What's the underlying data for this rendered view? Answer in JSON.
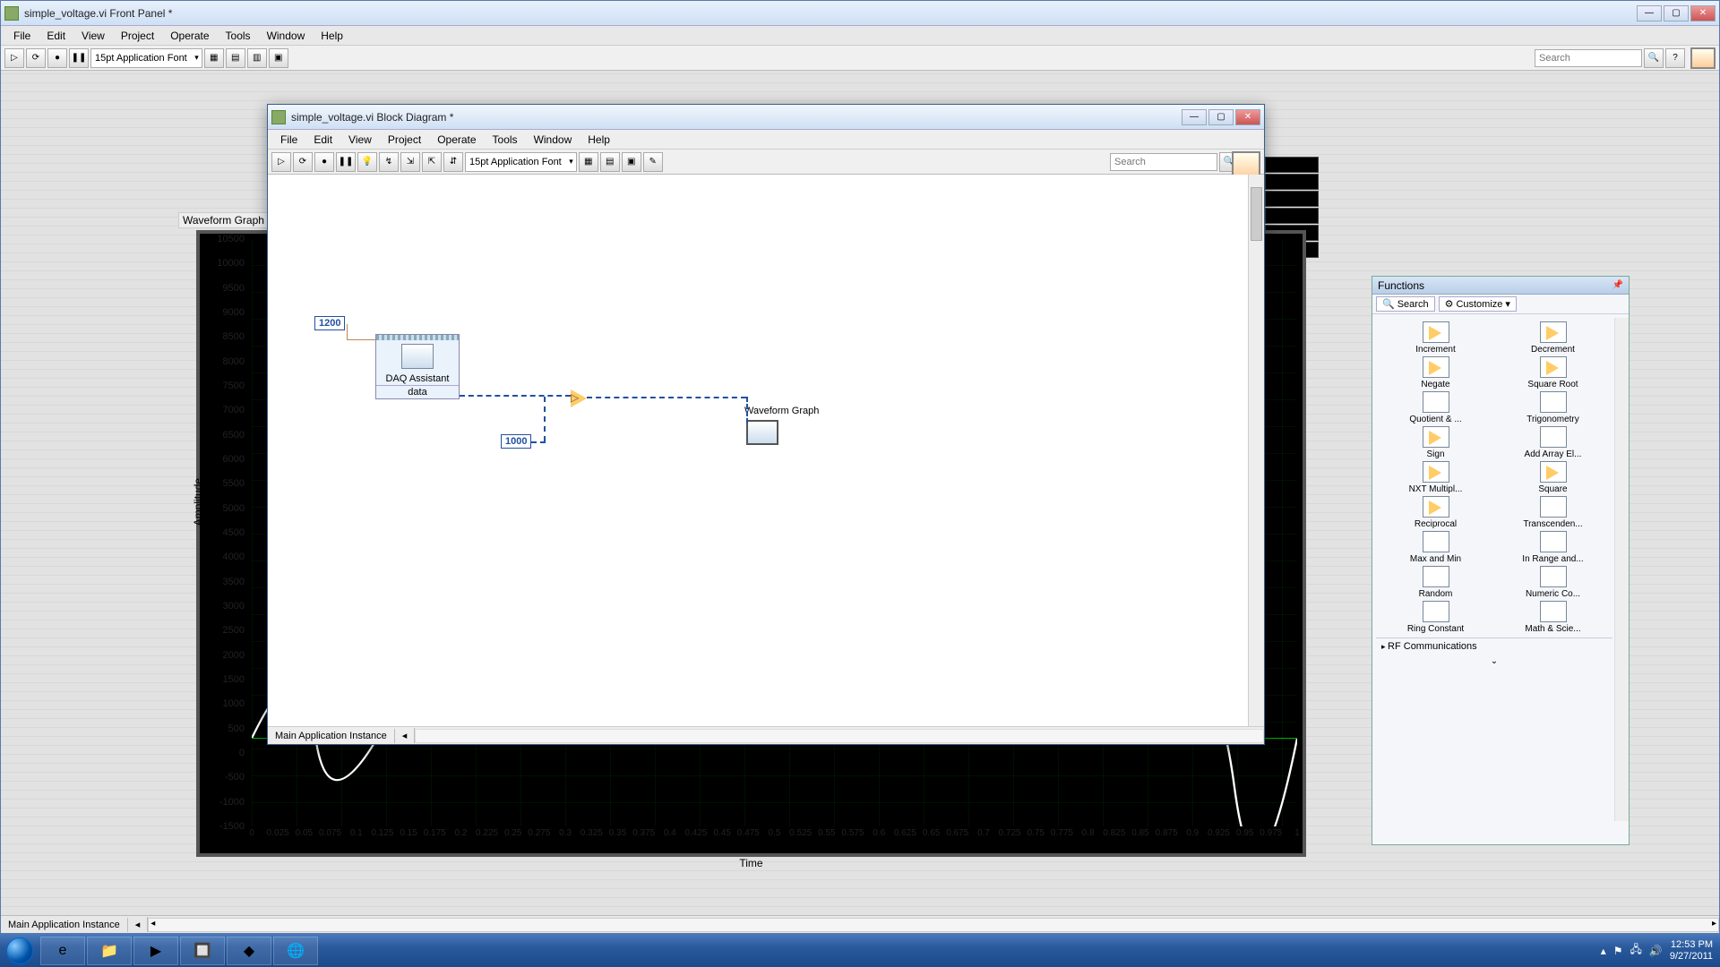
{
  "main_window": {
    "title": "simple_voltage.vi Front Panel *",
    "menus": [
      "File",
      "Edit",
      "View",
      "Project",
      "Operate",
      "Tools",
      "Window",
      "Help"
    ],
    "font_combo": "15pt Application Font",
    "search_placeholder": "Search",
    "status_tab": "Main Application Instance"
  },
  "graph": {
    "label": "Waveform Graph",
    "y_label": "Amplitude",
    "x_label": "Time",
    "y_ticks": [
      "10500",
      "10000",
      "9500",
      "9000",
      "8500",
      "8000",
      "7500",
      "7000",
      "6500",
      "6000",
      "5500",
      "5000",
      "4500",
      "4000",
      "3500",
      "3000",
      "2500",
      "2000",
      "1500",
      "1000",
      "500",
      "0",
      "-500",
      "-1000",
      "-1500"
    ],
    "x_ticks": [
      "0",
      "0.025",
      "0.05",
      "0.075",
      "0.1",
      "0.125",
      "0.15",
      "0.175",
      "0.2",
      "0.225",
      "0.25",
      "0.275",
      "0.3",
      "0.325",
      "0.35",
      "0.375",
      "0.4",
      "0.425",
      "0.45",
      "0.475",
      "0.5",
      "0.525",
      "0.55",
      "0.575",
      "0.6",
      "0.625",
      "0.65",
      "0.675",
      "0.7",
      "0.725",
      "0.75",
      "0.775",
      "0.8",
      "0.825",
      "0.85",
      "0.875",
      "0.9",
      "0.925",
      "0.95",
      "0.975",
      "1"
    ],
    "legend_count": 6
  },
  "child_window": {
    "title": "simple_voltage.vi Block Diagram *",
    "menus": [
      "File",
      "Edit",
      "View",
      "Project",
      "Operate",
      "Tools",
      "Window",
      "Help"
    ],
    "font_combo": "15pt Application Font",
    "search_placeholder": "Search",
    "status_tab": "Main Application Instance",
    "const1": "1200",
    "const2": "1000",
    "daq_name": "DAQ Assistant",
    "daq_data": "data",
    "graph_term": "Waveform Graph"
  },
  "palette": {
    "title": "Functions",
    "search": "Search",
    "customize": "Customize",
    "items": [
      "Increment",
      "Decrement",
      "Negate",
      "Square Root",
      "Quotient & ...",
      "Trigonometry",
      "Sign",
      "Add Array El...",
      "NXT Multipl...",
      "Square",
      "Reciprocal",
      "Transcenden...",
      "Max and Min",
      "In Range and...",
      "Random",
      "Numeric Co...",
      "Ring Constant",
      "Math & Scie..."
    ],
    "category": "RF Communications"
  },
  "clock": {
    "time": "12:53 PM",
    "date": "9/27/2011"
  }
}
